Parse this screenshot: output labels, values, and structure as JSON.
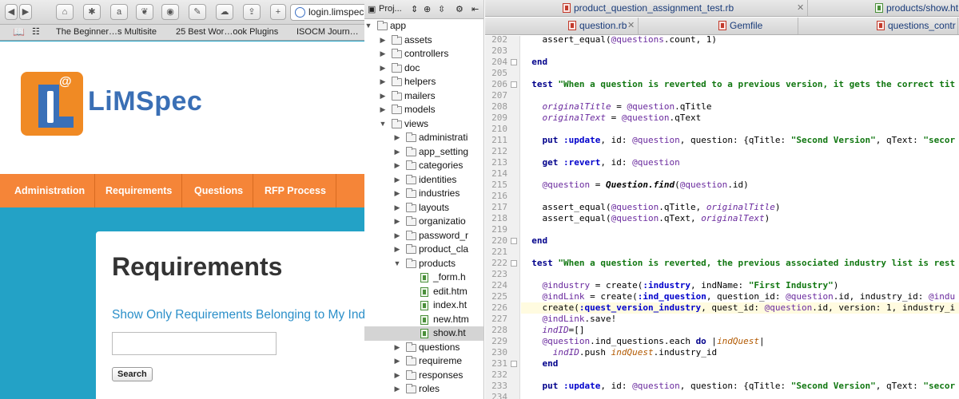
{
  "browser": {
    "address": "login.limspec",
    "bookmarks": [
      "The Beginner…s Multisite",
      "25 Best Wor…ook Plugins",
      "ISOCM Journ…"
    ],
    "brand": "LiMSpec",
    "logo_mark": "@",
    "nav": [
      "Administration",
      "Requirements",
      "Questions",
      "RFP Process"
    ],
    "page_title": "Requirements",
    "filter_link": "Show Only Requirements Belonging to My Indus",
    "search_value": "",
    "search_button": "Search"
  },
  "project_panel": {
    "title": "Proj...",
    "tree": [
      {
        "label": "app",
        "depth": 0,
        "expanded": true,
        "type": "folder"
      },
      {
        "label": "assets",
        "depth": 1,
        "expanded": false,
        "type": "folder"
      },
      {
        "label": "controllers",
        "depth": 1,
        "expanded": false,
        "type": "folder"
      },
      {
        "label": "doc",
        "depth": 1,
        "expanded": false,
        "type": "folder"
      },
      {
        "label": "helpers",
        "depth": 1,
        "expanded": false,
        "type": "folder"
      },
      {
        "label": "mailers",
        "depth": 1,
        "expanded": false,
        "type": "folder"
      },
      {
        "label": "models",
        "depth": 1,
        "expanded": false,
        "type": "folder"
      },
      {
        "label": "views",
        "depth": 1,
        "expanded": true,
        "type": "folder"
      },
      {
        "label": "administrati",
        "depth": 2,
        "expanded": false,
        "type": "folder"
      },
      {
        "label": "app_setting",
        "depth": 2,
        "expanded": false,
        "type": "folder"
      },
      {
        "label": "categories",
        "depth": 2,
        "expanded": false,
        "type": "folder"
      },
      {
        "label": "identities",
        "depth": 2,
        "expanded": false,
        "type": "folder"
      },
      {
        "label": "industries",
        "depth": 2,
        "expanded": false,
        "type": "folder"
      },
      {
        "label": "layouts",
        "depth": 2,
        "expanded": false,
        "type": "folder"
      },
      {
        "label": "organizatio",
        "depth": 2,
        "expanded": false,
        "type": "folder"
      },
      {
        "label": "password_r",
        "depth": 2,
        "expanded": false,
        "type": "folder"
      },
      {
        "label": "product_cla",
        "depth": 2,
        "expanded": false,
        "type": "folder"
      },
      {
        "label": "products",
        "depth": 2,
        "expanded": true,
        "type": "folder"
      },
      {
        "label": "_form.h",
        "depth": 3,
        "type": "file"
      },
      {
        "label": "edit.htm",
        "depth": 3,
        "type": "file"
      },
      {
        "label": "index.ht",
        "depth": 3,
        "type": "file"
      },
      {
        "label": "new.htm",
        "depth": 3,
        "type": "file"
      },
      {
        "label": "show.ht",
        "depth": 3,
        "type": "file",
        "selected": true
      },
      {
        "label": "questions",
        "depth": 2,
        "expanded": false,
        "type": "folder"
      },
      {
        "label": "requireme",
        "depth": 2,
        "expanded": false,
        "type": "folder"
      },
      {
        "label": "responses",
        "depth": 2,
        "expanded": false,
        "type": "folder"
      },
      {
        "label": "roles",
        "depth": 2,
        "expanded": false,
        "type": "folder"
      }
    ]
  },
  "editor": {
    "tabs_row1": [
      {
        "label": "product_question_assignment_test.rb",
        "color": "red"
      },
      {
        "label": "products/show.ht",
        "color": "green"
      }
    ],
    "tabs_row2": [
      {
        "label": "question.rb",
        "color": "red"
      },
      {
        "label": "Gemfile",
        "color": "red"
      },
      {
        "label": "questions_contr",
        "color": "red"
      }
    ],
    "first_line": 202,
    "current_line": 226,
    "lines": [
      "    assert_equal(@questions.count, 1)",
      "",
      "  end",
      "",
      "  test \"When a question is reverted to a previous version, it gets the correct tit",
      "",
      "    originalTitle = @question.qTitle",
      "    originalText = @question.qText",
      "",
      "    put :update, id: @question, question: {qTitle: \"Second Version\", qText: \"secor",
      "",
      "    get :revert, id: @question",
      "",
      "    @question = Question.find(@question.id)",
      "",
      "    assert_equal(@question.qTitle, originalTitle)",
      "    assert_equal(@question.qText, originalText)",
      "",
      "  end",
      "",
      "  test \"When a question is reverted, the previous associated industry list is rest",
      "",
      "    @industry = create(:industry, indName: \"First Industry\")",
      "    @indLink = create(:ind_question, question_id: @question.id, industry_id: @indu",
      "    create(:quest_version_industry, quest_id: @question.id, version: 1, industry_i",
      "    @indLink.save!",
      "    indID=[]",
      "    @question.ind_questions.each do |indQuest|",
      "      indID.push indQuest.industry_id",
      "    end",
      "",
      "    put :update, id: @question, question: {qTitle: \"Second Version\", qText: \"secor",
      ""
    ]
  }
}
